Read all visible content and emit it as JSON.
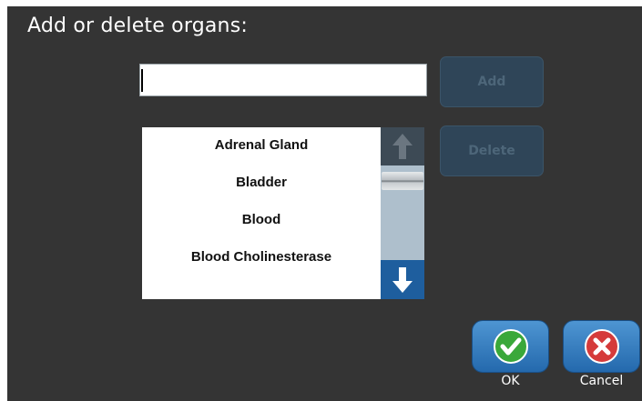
{
  "dialog": {
    "title": "Add or delete organs:",
    "input_value": "",
    "add_label": "Add",
    "delete_label": "Delete",
    "ok_label": "OK",
    "cancel_label": "Cancel"
  },
  "list": {
    "items": [
      "Adrenal Gland",
      "Bladder",
      "Blood",
      "Blood Cholinesterase"
    ]
  },
  "icons": {
    "scroll_up": "arrow-up-icon",
    "scroll_down": "arrow-down-icon",
    "ok": "check-circle-icon",
    "cancel": "x-circle-icon"
  },
  "colors": {
    "ok_green": "#3aa83a",
    "cancel_red": "#d53b3b",
    "button_blue": "#2f74b8"
  }
}
